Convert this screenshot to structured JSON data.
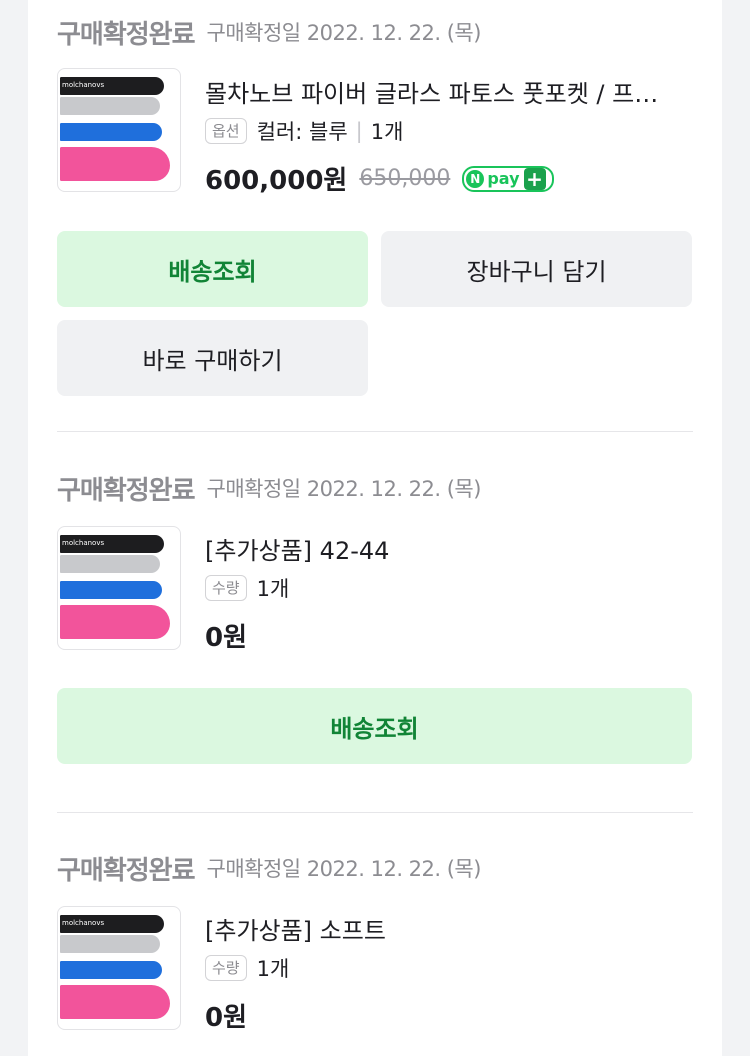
{
  "orders": [
    {
      "status": "구매확정완료",
      "date": "구매확정일 2022. 12. 22. (목)",
      "title": "몰차노브 파이버 글라스 파토스 풋포켓 / 프…",
      "option_badge": "옵션",
      "option_text": "컬러: 블루",
      "qty": "1개",
      "price": "600,000원",
      "original_price": "650,000",
      "npay_label": "pay",
      "buttons": [
        "배송조회",
        "장바구니 담기",
        "바로 구매하기"
      ]
    },
    {
      "status": "구매확정완료",
      "date": "구매확정일 2022. 12. 22. (목)",
      "title": "[추가상품] 42-44",
      "option_badge": "수량",
      "qty": "1개",
      "price": "0원",
      "buttons": [
        "배송조회"
      ]
    },
    {
      "status": "구매확정완료",
      "date": "구매확정일 2022. 12. 22. (목)",
      "title": "[추가상품] 소프트",
      "option_badge": "수량",
      "qty": "1개",
      "price": "0원"
    }
  ],
  "thumb_brand": "molchanovs",
  "colors": {
    "green_button_bg": "#dbf8e0",
    "green_button_text": "#118436",
    "gray_button_bg": "#f0f1f3",
    "npay_green": "#19c45a"
  }
}
